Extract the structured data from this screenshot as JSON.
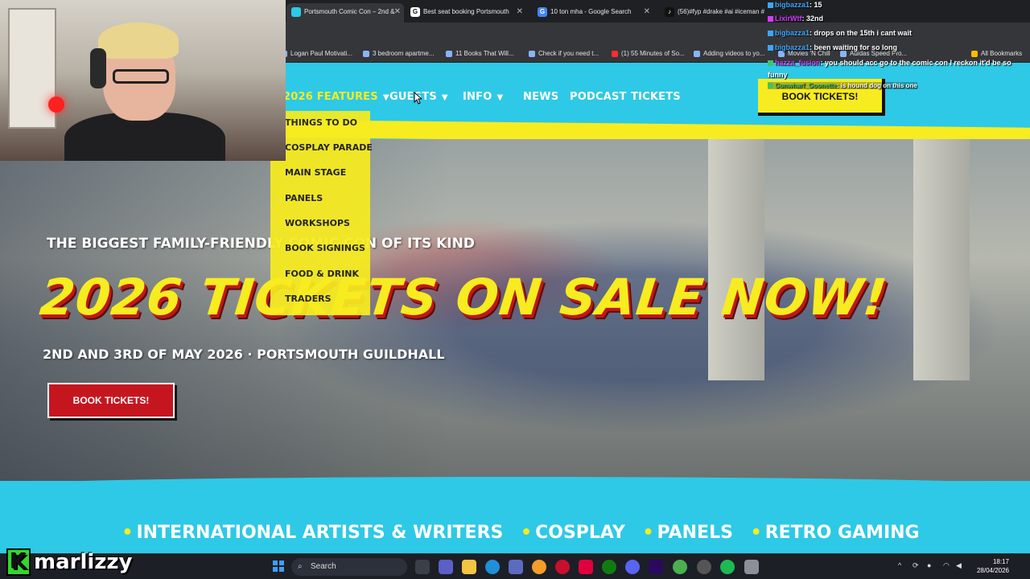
{
  "browser": {
    "tabs": [
      {
        "title": "Portsmouth Comic Con – 2nd &",
        "icon_color": "#2ec9e6",
        "active": true
      },
      {
        "title": "Best seat booking Portsmouth",
        "icon_color": "#ffffff",
        "active": false
      },
      {
        "title": "10 ton mha - Google Search",
        "icon_color": "#4285f4",
        "active": false
      },
      {
        "title": "(56)#fyp #drake #ai #iceman #",
        "icon_color": "#111111",
        "active": false
      }
    ],
    "bookmarks": [
      "Logan Paul Motivati...",
      "3 bedroom apartme...",
      "11 Books That Will...",
      "Check if you need t...",
      "(1) 55 Minutes of So...",
      "Adding videos to yo...",
      "Movies 'N Chill",
      "Adidas Speed Pro...",
      "All Bookmarks"
    ]
  },
  "site": {
    "nav": [
      {
        "label": "2026 FEATURES",
        "has_menu": true
      },
      {
        "label": "GUESTS",
        "has_menu": true
      },
      {
        "label": "INFO",
        "has_menu": true
      },
      {
        "label": "NEWS",
        "has_menu": false
      },
      {
        "label": "PODCAST",
        "has_menu": false
      },
      {
        "label": "TICKETS",
        "has_menu": false
      }
    ],
    "book_top": "BOOK TICKETS!",
    "dropdown": [
      "THINGS TO DO",
      "COSPLAY PARADE",
      "MAIN STAGE",
      "PANELS",
      "WORKSHOPS",
      "BOOK SIGNINGS",
      "FOOD & DRINK",
      "TRADERS"
    ],
    "tagline": "THE BIGGEST FAMILY-FRIENDLY COMIC CON OF ITS KIND",
    "headline": "2026 TICKETS ON SALE NOW!",
    "dates": "2ND AND 3RD OF MAY 2026 · PORTSMOUTH GUILDHALL",
    "book_hero": "BOOK TICKETS!",
    "features": [
      "INTERNATIONAL ARTISTS & WRITERS",
      "COSPLAY",
      "PANELS",
      "RETRO GAMING"
    ],
    "colors": {
      "accent_yellow": "#f7ec1f",
      "sky_blue": "#2ec9e6",
      "ticket_red": "#c5161f"
    }
  },
  "chat": [
    {
      "user": "bigbazza1",
      "text": ": 15"
    },
    {
      "user": "LixirWtf",
      "text": ": 32nd"
    },
    {
      "user": "bigbazza1",
      "text": ": drops on the 15th i cant wait"
    },
    {
      "user": "bigbazza1",
      "text": ": been waiting for so long"
    },
    {
      "user": "hazza_fusion",
      "text": ": you should acc go to the comic con I reckon it'd be so funny"
    },
    {
      "user": "Gunwharf_Goonette",
      "text": ": is hound dog on this one"
    }
  ],
  "streamer": {
    "name": "marlizzy",
    "badge_letter": "K"
  },
  "taskbar": {
    "search_label": "Search",
    "time": "18:17",
    "date": "28/04/2026"
  }
}
